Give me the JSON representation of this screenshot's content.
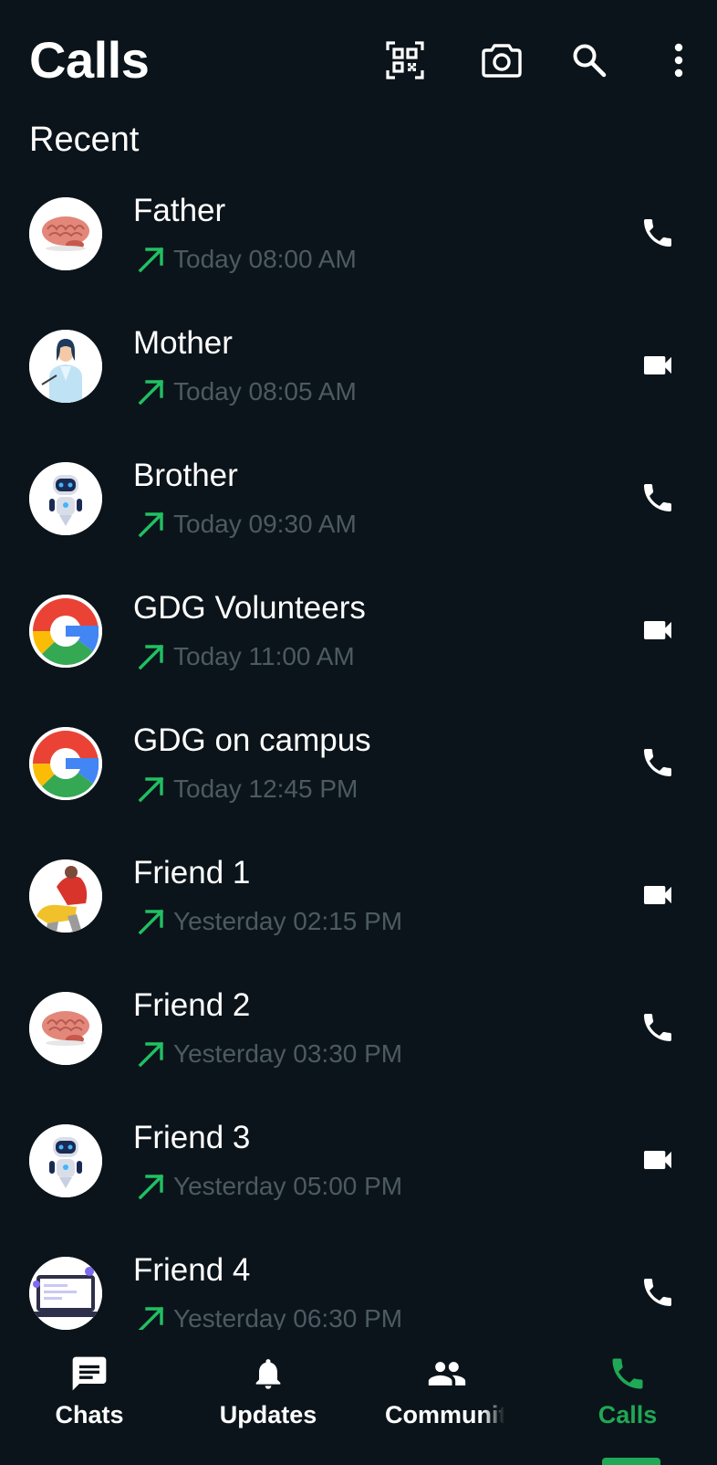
{
  "header": {
    "title": "Calls",
    "icons": [
      "qr-code-icon",
      "camera-icon",
      "search-icon",
      "more-vert-icon"
    ]
  },
  "section": {
    "title": "Recent"
  },
  "calls": [
    {
      "name": "Father",
      "time": "Today 08:00 AM",
      "type": "voice",
      "avatar": "brain"
    },
    {
      "name": "Mother",
      "time": "Today 08:05 AM",
      "type": "video",
      "avatar": "doctor"
    },
    {
      "name": "Brother",
      "time": "Today 09:30 AM",
      "type": "voice",
      "avatar": "robot"
    },
    {
      "name": "GDG Volunteers",
      "time": "Today 11:00 AM",
      "type": "video",
      "avatar": "google"
    },
    {
      "name": "GDG on campus",
      "time": "Today 12:45 PM",
      "type": "voice",
      "avatar": "google"
    },
    {
      "name": "Friend 1",
      "time": "Yesterday 02:15 PM",
      "type": "video",
      "avatar": "person"
    },
    {
      "name": "Friend 2",
      "time": "Yesterday 03:30 PM",
      "type": "voice",
      "avatar": "brain"
    },
    {
      "name": "Friend 3",
      "time": "Yesterday 05:00 PM",
      "type": "video",
      "avatar": "robot"
    },
    {
      "name": "Friend 4",
      "time": "Yesterday 06:30 PM",
      "type": "voice",
      "avatar": "laptop"
    }
  ],
  "bottom_nav": {
    "items": [
      {
        "label": "Chats",
        "icon": "chat-icon",
        "active": false
      },
      {
        "label": "Updates",
        "icon": "bell-icon",
        "active": false
      },
      {
        "label": "Communit",
        "icon": "community-icon",
        "active": false
      },
      {
        "label": "Calls",
        "icon": "phone-icon",
        "active": true
      }
    ]
  },
  "colors": {
    "background": "#0b141a",
    "text_primary": "#ffffff",
    "text_secondary": "#4d5a61",
    "outgoing_arrow": "#21c063",
    "accent": "#1fa855"
  }
}
